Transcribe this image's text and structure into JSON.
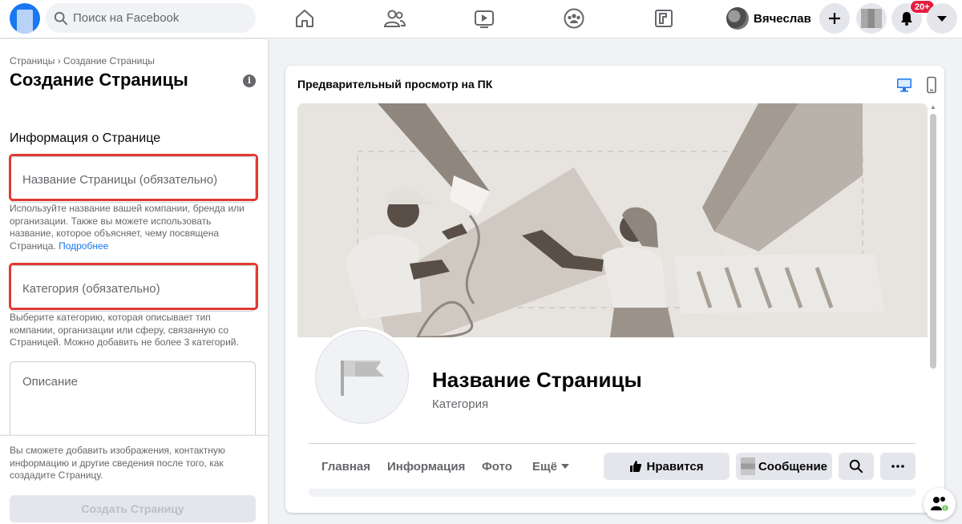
{
  "topbar": {
    "search_placeholder": "Поиск на Facebook",
    "user_name": "Вячеслав",
    "notifications_badge": "20+",
    "nav_icons": [
      "home-icon",
      "friends-icon",
      "watch-icon",
      "groups-icon",
      "gaming-icon"
    ]
  },
  "sidebar": {
    "breadcrumb_parent": "Страницы",
    "breadcrumb_separator": "›",
    "breadcrumb_current": "Создание Страницы",
    "title": "Создание Страницы",
    "section_title": "Информация о Странице",
    "name_field": {
      "placeholder": "Название Страницы (обязательно)",
      "help": "Используйте название вашей компании, бренда или организации. Также вы можете использовать название, которое объясняет, чему посвящена Страница.",
      "help_link": "Подробнее"
    },
    "category_field": {
      "placeholder": "Категория (обязательно)",
      "help": "Выберите категорию, которая описывает тип компании, организации или сферу, связанную со Страницей. Можно добавить не более 3 категорий."
    },
    "description_field": {
      "placeholder": "Описание"
    },
    "footer_note": "Вы сможете добавить изображения, контактную информацию и другие сведения после того, как создадите Страницу.",
    "create_button": "Создать Страницу"
  },
  "preview": {
    "title": "Предварительный просмотр на ПК",
    "page_name": "Название Страницы",
    "page_category": "Категория",
    "tabs": [
      "Главная",
      "Информация",
      "Фото",
      "Ещё"
    ],
    "like_button": "Нравится",
    "message_button": "Сообщение"
  },
  "colors": {
    "brand": "#1877f2",
    "highlight_frame": "#e03a31",
    "badge": "#e41e3f"
  }
}
